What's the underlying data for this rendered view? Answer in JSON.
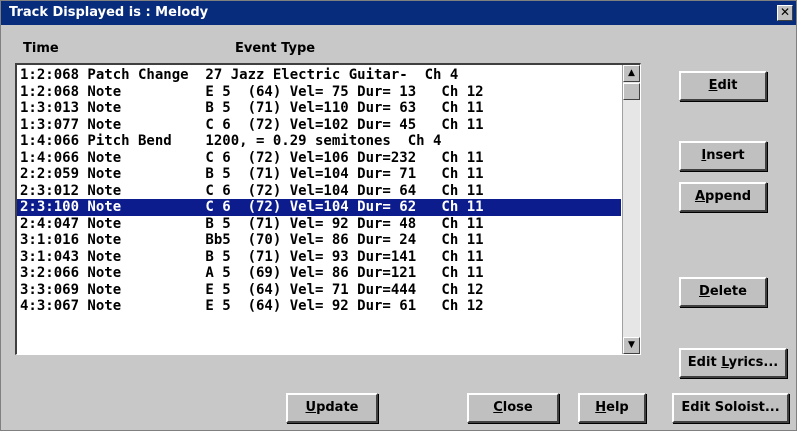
{
  "window": {
    "title": "Track Displayed is : Melody",
    "close_glyph": "✕"
  },
  "columns": {
    "time": "Time",
    "event_type": "Event Type"
  },
  "events": [
    "1:2:068 Patch Change  27 Jazz Electric Guitar-  Ch 4",
    "1:2:068 Note          E 5  (64) Vel= 75 Dur= 13   Ch 12",
    "1:3:013 Note          B 5  (71) Vel=110 Dur= 63   Ch 11",
    "1:3:077 Note          C 6  (72) Vel=102 Dur= 45   Ch 11",
    "1:4:066 Pitch Bend    1200, = 0.29 semitones  Ch 4",
    "1:4:066 Note          C 6  (72) Vel=106 Dur=232   Ch 11",
    "2:2:059 Note          B 5  (71) Vel=104 Dur= 71   Ch 11",
    "2:3:012 Note          C 6  (72) Vel=104 Dur= 64   Ch 11",
    "2:3:100 Note          C 6  (72) Vel=104 Dur= 62   Ch 11",
    "2:4:047 Note          B 5  (71) Vel= 92 Dur= 48   Ch 11",
    "3:1:016 Note          Bb5  (70) Vel= 86 Dur= 24   Ch 11",
    "3:1:043 Note          B 5  (71) Vel= 93 Dur=141   Ch 11",
    "3:2:066 Note          A 5  (69) Vel= 86 Dur=121   Ch 11",
    "3:3:069 Note          E 5  (64) Vel= 71 Dur=444   Ch 12",
    "4:3:067 Note          E 5  (64) Vel= 92 Dur= 61   Ch 12"
  ],
  "selected_index": 8,
  "scrollbar": {
    "up_glyph": "▲",
    "down_glyph": "▼"
  },
  "buttons": {
    "edit": {
      "mnemonic": "E",
      "rest": "dit"
    },
    "insert": {
      "mnemonic": "I",
      "rest": "nsert"
    },
    "append": {
      "mnemonic": "A",
      "rest": "ppend"
    },
    "delete": {
      "mnemonic": "D",
      "rest": "elete"
    },
    "edit_lyrics": {
      "before": "Edit ",
      "mnemonic": "L",
      "rest": "yrics..."
    },
    "update": {
      "mnemonic": "U",
      "rest": "pdate"
    },
    "close": {
      "mnemonic": "C",
      "rest": "lose"
    },
    "help": {
      "mnemonic": "H",
      "rest": "elp"
    },
    "edit_soloist": {
      "label": "Edit Soloist..."
    }
  },
  "colors": {
    "titlebar": "#082c7c",
    "selection": "#0c1c8c"
  }
}
